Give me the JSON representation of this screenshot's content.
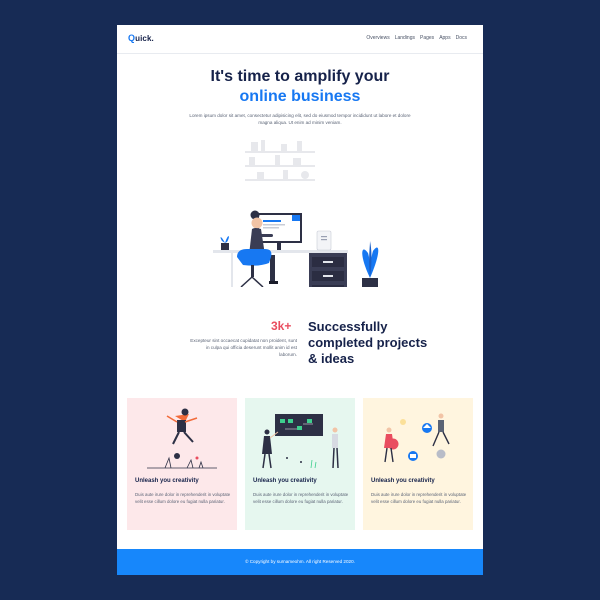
{
  "header": {
    "logo_q": "Q",
    "logo_rest": "uick.",
    "nav": [
      "Overviews",
      "Landings",
      "Pages",
      "Apps",
      "Docs"
    ]
  },
  "hero": {
    "title_line1": "It's time to amplify your",
    "title_line2": "online business",
    "text": "Lorem ipsum dolor sit amet, consectetur adipisicing elit, sed do eiusmod tempor incididunt ut labore et dolore magna aliqua. Ut enim ad minim veniam."
  },
  "stats": {
    "number": "3k+",
    "description": "Excepteur sint occaecat cupidatat non proident, sunt in culpa qui officia deserunt mollit anim id est laborum.",
    "title": "Successfully completed projects & ideas"
  },
  "cards": [
    {
      "title": "Unleash you creativity",
      "text": "Duis aute irure dolor in reprehenderit in voluptate velit esse cillum dolore eu fugiat nulla pariatur.",
      "bg": "#fde8ea"
    },
    {
      "title": "Unleash you creativity",
      "text": "Duis aute irure dolor in reprehenderit in voluptate velit esse cillum dolore eu fugiat nulla pariatur.",
      "bg": "#e6f7ef"
    },
    {
      "title": "Unleash you creativity",
      "text": "Duis aute irure dolor in reprehenderit in voluptate velit esse cillum dolore eu fugiat nulla pariatur.",
      "bg": "#fff5df"
    }
  ],
  "footer": {
    "text": "© Copyright by surnameohm. All right Reserved 2020."
  },
  "colors": {
    "background": "#172b55",
    "accent": "#1778f2",
    "highlight": "#e94d5f",
    "footer": "#1787fb",
    "heading": "#16224a"
  }
}
